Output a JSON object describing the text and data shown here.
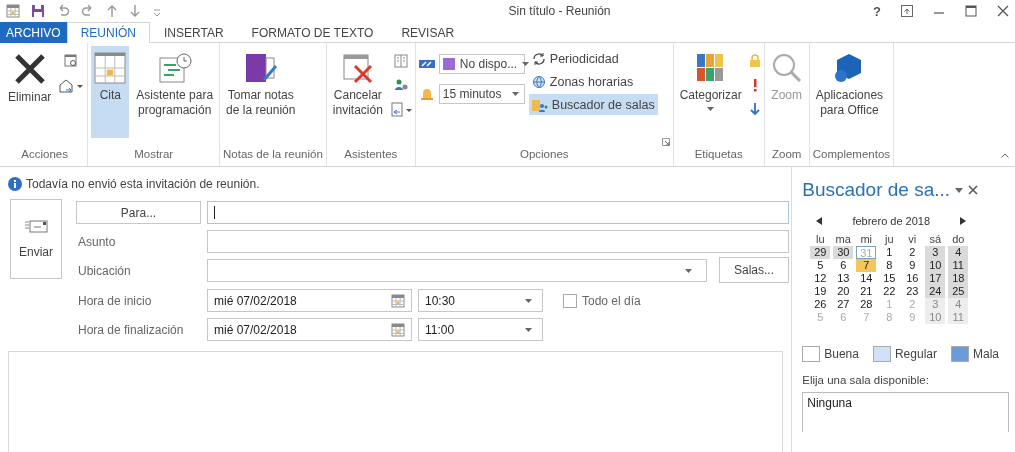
{
  "window": {
    "title": "Sin título - Reunión",
    "help": "?"
  },
  "tabs": [
    {
      "label": "ARCHIVO",
      "kind": "file",
      "selected": false
    },
    {
      "label": "REUNIÓN",
      "kind": "tab",
      "selected": true
    },
    {
      "label": "INSERTAR",
      "kind": "tab",
      "selected": false
    },
    {
      "label": "FORMATO DE TEXTO",
      "kind": "tab",
      "selected": false
    },
    {
      "label": "REVISAR",
      "kind": "tab",
      "selected": false
    }
  ],
  "ribbon": {
    "groups": [
      {
        "label": "Acciones",
        "delete": "Eliminar"
      },
      {
        "label": "Mostrar",
        "appointment": {
          "label": "Cita",
          "selected": true
        },
        "scheduling": "Asistente para\nprogramación"
      },
      {
        "label": "Notas de la reunión",
        "notes": "Tomar notas\nde la reunión"
      },
      {
        "label": "Asistentes",
        "cancel": "Cancelar\ninvitación"
      },
      {
        "label": "Opciones",
        "show_as": "No dispo...",
        "reminder": "15 minutos",
        "recurrence": "Periodicidad",
        "time_zones": "Zonas horarias",
        "room_finder": {
          "label": "Buscador de salas",
          "selected": true
        }
      },
      {
        "label": "Etiquetas",
        "categorize": "Categorizar"
      },
      {
        "label": "Zoom",
        "zoom": {
          "label": "Zoom",
          "disabled": true
        }
      },
      {
        "label": "Complementos",
        "apps": "Aplicaciones\npara Office"
      }
    ]
  },
  "info_message": "Todavía no envió esta invitación de reunión.",
  "form": {
    "send": "Enviar",
    "to_button": "Para...",
    "subject_label": "Asunto",
    "location_label": "Ubicación",
    "rooms_button": "Salas...",
    "start_label": "Hora de inicio",
    "start_date": "mié 07/02/2018",
    "start_time": "10:30",
    "end_label": "Hora de finalización",
    "end_date": "mié 07/02/2018",
    "end_time": "11:00",
    "all_day": {
      "label": "Todo el día",
      "checked": false
    }
  },
  "room_finder": {
    "title": "Buscador de sa...",
    "month": "febrero de 2018",
    "weekdays": [
      "lu",
      "ma",
      "mi",
      "ju",
      "vi",
      "sá",
      "do"
    ],
    "weeks": [
      [
        {
          "day": "29",
          "kind": "shaded"
        },
        {
          "day": "30",
          "kind": "shaded"
        },
        {
          "day": "31",
          "kind": "today"
        },
        {
          "day": "1",
          "kind": "normal"
        },
        {
          "day": "2",
          "kind": "normal"
        },
        {
          "day": "3",
          "kind": "shaded"
        },
        {
          "day": "4",
          "kind": "shaded"
        }
      ],
      [
        {
          "day": "5",
          "kind": "normal"
        },
        {
          "day": "6",
          "kind": "normal"
        },
        {
          "day": "7",
          "kind": "selected"
        },
        {
          "day": "8",
          "kind": "normal"
        },
        {
          "day": "9",
          "kind": "normal"
        },
        {
          "day": "10",
          "kind": "shaded"
        },
        {
          "day": "11",
          "kind": "shaded"
        }
      ],
      [
        {
          "day": "12",
          "kind": "normal"
        },
        {
          "day": "13",
          "kind": "normal"
        },
        {
          "day": "14",
          "kind": "normal"
        },
        {
          "day": "15",
          "kind": "normal"
        },
        {
          "day": "16",
          "kind": "normal"
        },
        {
          "day": "17",
          "kind": "shaded"
        },
        {
          "day": "18",
          "kind": "shaded"
        }
      ],
      [
        {
          "day": "19",
          "kind": "normal"
        },
        {
          "day": "20",
          "kind": "normal"
        },
        {
          "day": "21",
          "kind": "normal"
        },
        {
          "day": "22",
          "kind": "normal"
        },
        {
          "day": "23",
          "kind": "normal"
        },
        {
          "day": "24",
          "kind": "shaded"
        },
        {
          "day": "25",
          "kind": "shaded"
        }
      ],
      [
        {
          "day": "26",
          "kind": "normal"
        },
        {
          "day": "27",
          "kind": "normal"
        },
        {
          "day": "28",
          "kind": "normal"
        },
        {
          "day": "1",
          "kind": "dim"
        },
        {
          "day": "2",
          "kind": "dim"
        },
        {
          "day": "3",
          "kind": "dim-shaded"
        },
        {
          "day": "4",
          "kind": "dim-shaded"
        }
      ],
      [
        {
          "day": "5",
          "kind": "dim"
        },
        {
          "day": "6",
          "kind": "dim"
        },
        {
          "day": "7",
          "kind": "dim"
        },
        {
          "day": "8",
          "kind": "dim"
        },
        {
          "day": "9",
          "kind": "dim"
        },
        {
          "day": "10",
          "kind": "dim-shaded"
        },
        {
          "day": "11",
          "kind": "dim-shaded"
        }
      ]
    ],
    "legend": [
      {
        "label": "Buena",
        "color": "#ffffff"
      },
      {
        "label": "Regular",
        "color": "#cfe2f6"
      },
      {
        "label": "Mala",
        "color": "#6b9bd9"
      }
    ],
    "prompt": "Elija una sala disponible:",
    "rooms": [
      "Ninguna"
    ]
  }
}
